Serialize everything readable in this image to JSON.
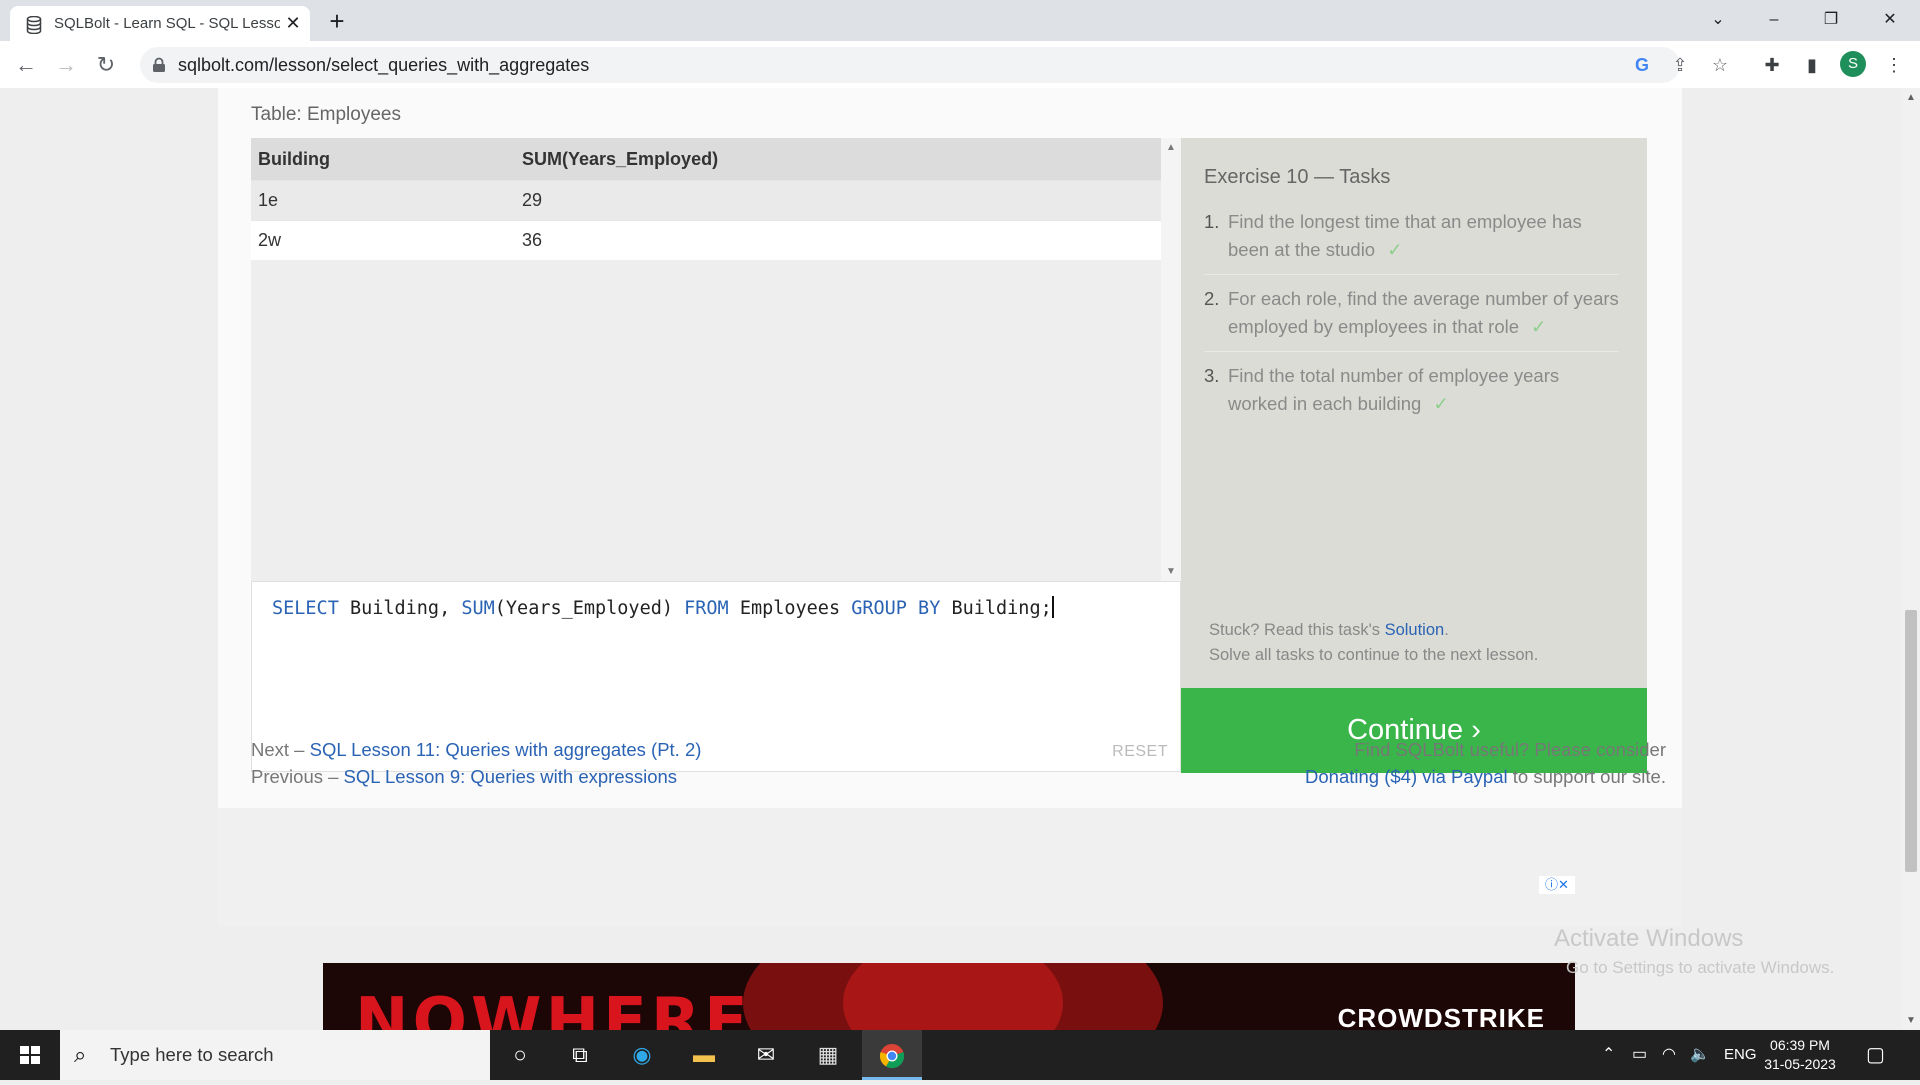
{
  "browser": {
    "tab_title": "SQLBolt - Learn SQL - SQL Lesson",
    "url": "sqlbolt.com/lesson/select_queries_with_aggregates",
    "profile_initial": "S",
    "new_tab_symbol": "+"
  },
  "page": {
    "table_caption": "Table: Employees",
    "result": {
      "headers": [
        "Building",
        "SUM(Years_Employed)"
      ],
      "rows": [
        [
          "1e",
          "29"
        ],
        [
          "2w",
          "36"
        ]
      ]
    },
    "editor": {
      "query": "SELECT Building, SUM(Years_Employed) FROM Employees GROUP BY Building;",
      "reset_label": "RESET"
    },
    "exercise": {
      "title": "Exercise 10 — Tasks",
      "tasks": [
        {
          "num": "1.",
          "text": "Find the longest time that an employee has been at the studio",
          "done": "✓"
        },
        {
          "num": "2.",
          "text": "For each role, find the average number of years employed by employees in that role",
          "done": "✓"
        },
        {
          "num": "3.",
          "text": "Find the total number of employee years worked in each building",
          "done": "✓"
        }
      ],
      "stuck_prefix": "Stuck? Read this task's",
      "solution_link": "Solution",
      "stuck_suffix": ".",
      "solve_all": "Solve all tasks to continue to the next lesson.",
      "continue_label": "Continue ›"
    },
    "footer": {
      "next_prefix": "Next –",
      "next_link": "SQL Lesson 11: Queries with aggregates (Pt. 2)",
      "prev_prefix": "Previous –",
      "prev_link": "SQL Lesson 9: Queries with expressions",
      "useful": "Find SQLBolt useful? Please consider",
      "donate_link": "Donating ($4) via Paypal",
      "donate_suffix": "to support our site."
    },
    "ad": {
      "left_text": "NOWHERE",
      "brand": "CROWDSTRIKE"
    },
    "watermark": {
      "line1": "Activate Windows",
      "line2": "Go to Settings to activate Windows."
    }
  },
  "taskbar": {
    "search_placeholder": "Type here to search",
    "language": "ENG",
    "time": "06:39 PM",
    "date": "31-05-2023"
  },
  "colors": {
    "continue_green": "#3ab54a",
    "link_blue": "#2b63b4",
    "check_green": "#8ccf8c"
  }
}
